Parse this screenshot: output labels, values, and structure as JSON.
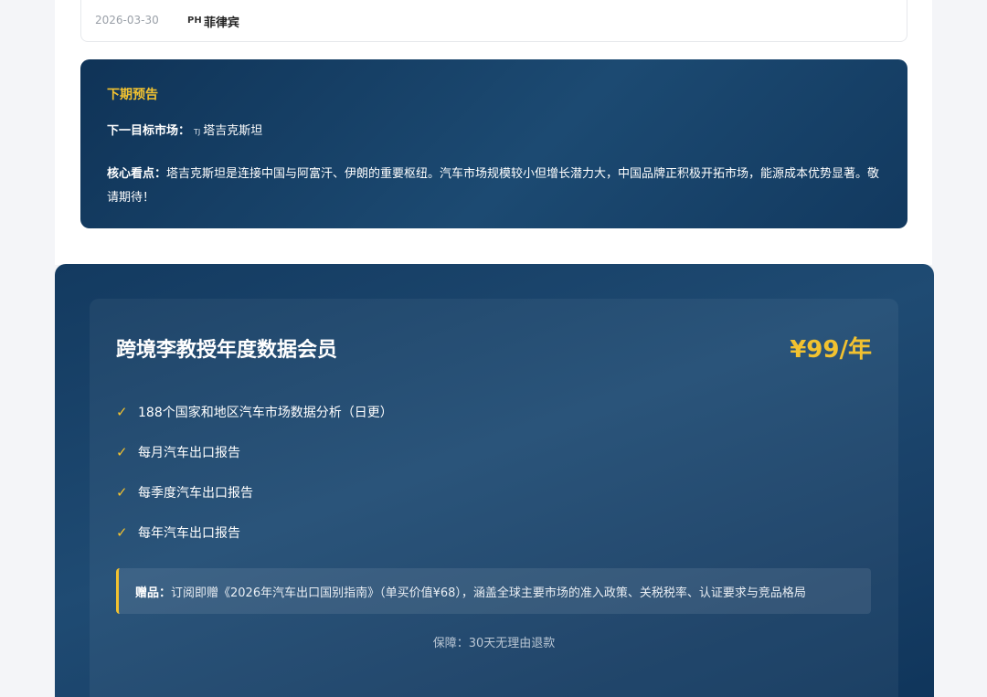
{
  "date_row": {
    "date": "2026-03-30",
    "country_code": "PH",
    "country": "菲律宾"
  },
  "preview": {
    "title": "下期预告",
    "target_label": "下一目标市场：",
    "target_code": "TJ",
    "target_country": "塔吉克斯坦",
    "highlight_label": "核心看点：",
    "highlight_text": "塔吉克斯坦是连接中国与阿富汗、伊朗的重要枢纽。汽车市场规模较小但增长潜力大，中国品牌正积极开拓市场，能源成本优势显著。敬请期待！"
  },
  "membership": {
    "title": "跨境李教授年度数据会员",
    "price": "¥99/年",
    "check_icon": "✓",
    "features": [
      "188个国家和地区汽车市场数据分析（日更）",
      "每月汽车出口报告",
      "每季度汽车出口报告",
      "每年汽车出口报告"
    ],
    "gift_label": "赠品：",
    "gift_text": "订阅即赠《2026年汽车出口国别指南》（单买价值¥68），涵盖全球主要市场的准入政策、关税税率、认证要求与竞品格局",
    "guarantee": "保障：30天无理由退款"
  },
  "colors": {
    "accent": "#f2c230",
    "navy": "#133a60"
  }
}
